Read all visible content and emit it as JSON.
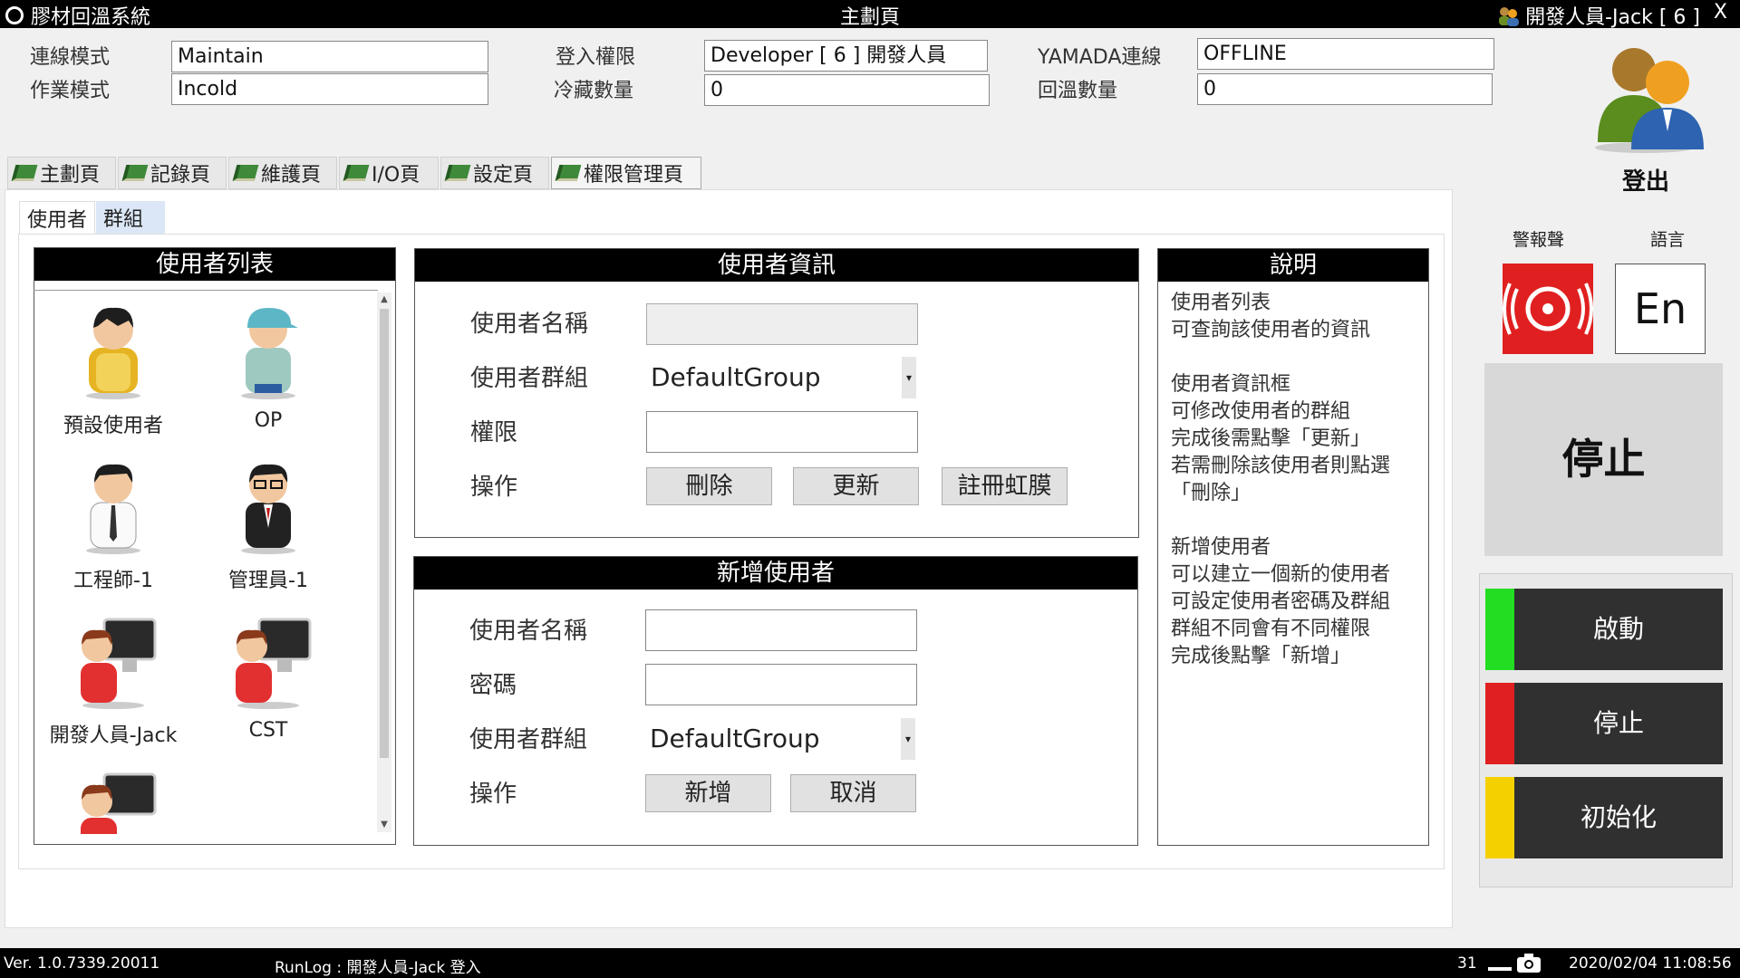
{
  "titlebar": {
    "app_title": "膠材回溫系統",
    "page_title": "主劃頁",
    "user": "開發人員-Jack [ 6 ]",
    "close": "X"
  },
  "header": {
    "connect_mode": {
      "label": "連線模式",
      "value": "Maintain"
    },
    "work_mode": {
      "label": "作業模式",
      "value": "Incold"
    },
    "login_level": {
      "label": "登入權限",
      "value": "Developer [ 6 ] 開發人員"
    },
    "cold_count": {
      "label": "冷藏數量",
      "value": "0"
    },
    "yamada": {
      "label": "YAMADA連線",
      "value": "OFFLINE"
    },
    "warm_count": {
      "label": "回溫數量",
      "value": "0"
    },
    "logout": "登出"
  },
  "tabs": [
    {
      "label": "主劃頁"
    },
    {
      "label": "記錄頁"
    },
    {
      "label": "維護頁"
    },
    {
      "label": "I/O頁"
    },
    {
      "label": "設定頁"
    },
    {
      "label": "權限管理頁"
    }
  ],
  "subtabs": [
    {
      "label": "使用者"
    },
    {
      "label": "群組"
    }
  ],
  "user_list": {
    "title": "使用者列表",
    "users": [
      {
        "name": "預設使用者",
        "icon": "student-avatar-icon"
      },
      {
        "name": "OP",
        "icon": "worker-avatar-icon"
      },
      {
        "name": "工程師-1",
        "icon": "engineer-avatar-icon"
      },
      {
        "name": "管理員-1",
        "icon": "manager-avatar-icon"
      },
      {
        "name": "開發人員-Jack",
        "icon": "developer-avatar-icon"
      },
      {
        "name": "CST",
        "icon": "developer-avatar-icon"
      }
    ]
  },
  "user_info": {
    "title": "使用者資訊",
    "name_label": "使用者名稱",
    "group_label": "使用者群組",
    "group_value": "DefaultGroup",
    "perm_label": "權限",
    "op_label": "操作",
    "delete": "刪除",
    "update": "更新",
    "iris": "註冊虹膜"
  },
  "add_user": {
    "title": "新增使用者",
    "name_label": "使用者名稱",
    "password_label": "密碼",
    "group_label": "使用者群組",
    "group_value": "DefaultGroup",
    "op_label": "操作",
    "add": "新增",
    "cancel": "取消"
  },
  "help": {
    "title": "說明",
    "text": "使用者列表\n可查詢該使用者的資訊\n\n使用者資訊框\n可修改使用者的群組\n完成後需點擊「更新」\n若需刪除該使用者則點選\n「刪除」\n\n新增使用者\n可以建立一個新的使用者\n可設定使用者密碼及群組\n群組不同會有不同權限\n完成後點擊「新增」"
  },
  "side": {
    "alarm_label": "警報聲",
    "lang_label": "語言",
    "lang_value": "En",
    "stop_big": "停止",
    "start": "啟動",
    "stop": "停止",
    "init": "初始化",
    "colors": {
      "start": "#22dd22",
      "stop": "#e02020",
      "init": "#f5d000",
      "alarm": "#e02020"
    }
  },
  "status": {
    "version": "Ver. 1.0.7339.20011",
    "runlog": "RunLog : 開發人員-Jack 登入",
    "count": "31",
    "datetime": "2020/02/04 11:08:56"
  }
}
